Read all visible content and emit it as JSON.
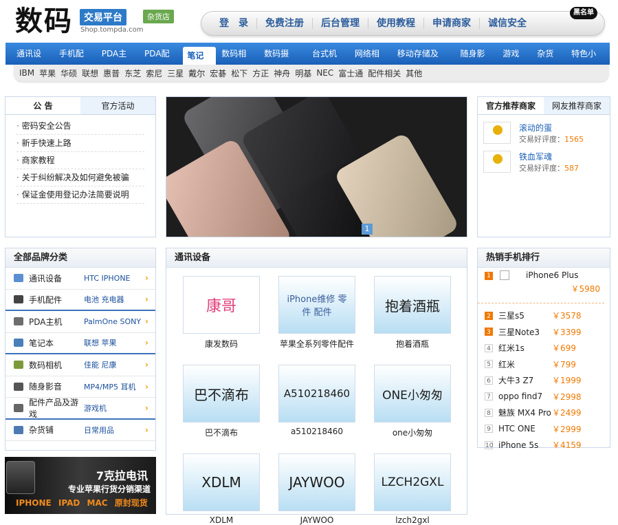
{
  "header": {
    "logo_big": "数码",
    "trade_label": "交易平台",
    "url": "Shop.tompda.com",
    "shop_badge": "杂货店",
    "blacklist": "黑名单",
    "nav": [
      "登　录",
      "免费注册",
      "后台管理",
      "使用教程",
      "申请商家",
      "诚信安全"
    ]
  },
  "categories": {
    "main": [
      "通讯设备",
      "手机配件",
      "PDA主机",
      "PDA配件",
      "笔记本",
      "数码相机",
      "数码摄录",
      "台式机柜",
      "网络相关",
      "移动存储及耗",
      "随身影音",
      "游戏机",
      "杂货店",
      "特色小铺"
    ],
    "active": "笔记本",
    "sub": [
      "IBM",
      "苹果",
      "华硕",
      "联想",
      "惠普",
      "东芝",
      "索尼",
      "三星",
      "戴尔",
      "宏碁",
      "松下",
      "方正",
      "神舟",
      "明基",
      "NEC",
      "富士通",
      "配件相关",
      "其他"
    ]
  },
  "notice": {
    "tabs": [
      "公 告",
      "官方活动"
    ],
    "items": [
      "密码安全公告",
      "新手快速上路",
      "商家教程",
      "关于纠纷解决及如何避免被骗",
      "保证金使用登记办法简要说明"
    ]
  },
  "slider": {
    "indicator": "1"
  },
  "merchants": {
    "tabs": [
      "官方推荐商家",
      "网友推荐商家"
    ],
    "items": [
      {
        "name": "滚动的蛋",
        "rate_label": "交易好评度：",
        "rate": "1565"
      },
      {
        "name": "铁血军魂",
        "rate_label": "交易好评度：",
        "rate": "587"
      }
    ]
  },
  "brands": {
    "title": "全部品牌分类",
    "rows": [
      {
        "name": "通讯设备",
        "brands": "HTC  IPHONE",
        "icon": "phone-icon",
        "color": "#5b8fd0"
      },
      {
        "name": "手机配件",
        "brands": "电池  充电器",
        "icon": "headset-icon",
        "color": "#444444"
      },
      {
        "name": "PDA主机",
        "brands": "PalmOne  SONY",
        "icon": "pda-icon",
        "color": "#6d6d6d"
      },
      {
        "name": "笔记本",
        "brands": "联想  苹果",
        "icon": "laptop-icon",
        "color": "#4a7fb8"
      },
      {
        "name": "数码相机",
        "brands": "佳能  尼康",
        "icon": "camera-icon",
        "color": "#7d9a3a"
      },
      {
        "name": "随身影音",
        "brands": "MP4/MP5  耳机",
        "icon": "media-player-icon",
        "color": "#555555"
      },
      {
        "name": "配件产品及游戏",
        "brands": "游戏机",
        "icon": "gamepad-icon",
        "color": "#666666"
      },
      {
        "name": "杂货铺",
        "brands": "日常用品",
        "icon": "store-icon",
        "color": "#4d7ab2"
      }
    ]
  },
  "ad": {
    "title": "7克拉电讯",
    "subtitle": "专业苹果行货分销渠道",
    "tags": "IPHONE  IPAD  MAC  原封现货"
  },
  "comm": {
    "title": "通讯设备",
    "items": [
      {
        "img_text": "康哥",
        "caption": "康发数码"
      },
      {
        "img_text": "iPhone维修 零件 配件",
        "caption": "苹果全系列零件配件"
      },
      {
        "img_text": "抱着酒瓶",
        "caption": "抱着酒瓶"
      },
      {
        "img_text": "巴不滴布",
        "caption": "巴不滴布"
      },
      {
        "img_text": "A510218460",
        "caption": "a510218460"
      },
      {
        "img_text": "ONE小匆匆",
        "caption": "one小匆匆"
      },
      {
        "img_text": "XDLM",
        "caption": "XDLM"
      },
      {
        "img_text": "JAYWOO",
        "caption": "JAYWOO"
      },
      {
        "img_text": "LZCH2GXL",
        "caption": "lzch2gxl"
      }
    ]
  },
  "hot": {
    "title": "热销手机排行",
    "items": [
      {
        "rank": "1",
        "name": "iPhone6 Plus",
        "price": "￥5980"
      },
      {
        "rank": "2",
        "name": "三星s5",
        "price": "￥3578"
      },
      {
        "rank": "3",
        "name": "三星Note3",
        "price": "￥3399"
      },
      {
        "rank": "4",
        "name": "红米1s",
        "price": "￥699"
      },
      {
        "rank": "5",
        "name": "红米",
        "price": "￥799"
      },
      {
        "rank": "6",
        "name": "大牛3 Z7",
        "price": "￥1999"
      },
      {
        "rank": "7",
        "name": "oppo find7",
        "price": "￥2998"
      },
      {
        "rank": "8",
        "name": "魅族 MX4 Pro",
        "price": "￥2499"
      },
      {
        "rank": "9",
        "name": "HTC ONE",
        "price": "￥2999"
      },
      {
        "rank": "10",
        "name": "iPhone 5s",
        "price": "￥4159"
      }
    ]
  }
}
